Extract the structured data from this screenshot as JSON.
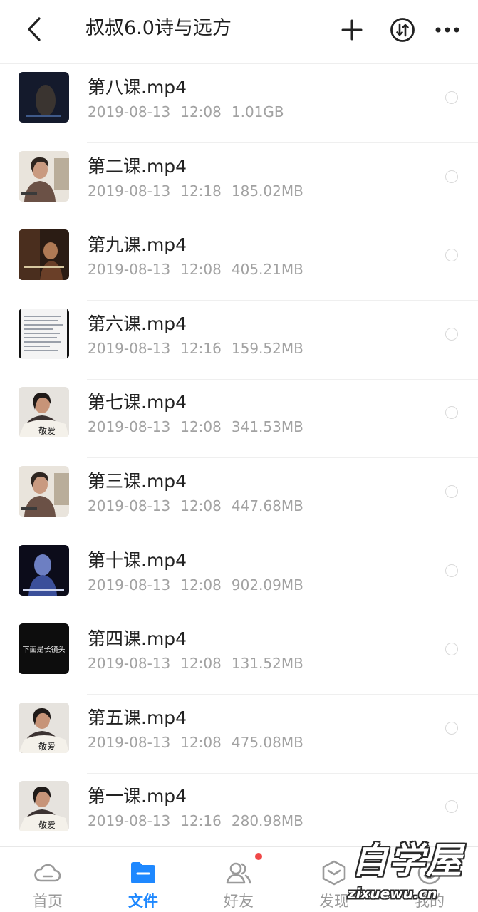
{
  "header": {
    "title": "叔叔6.0诗与远方",
    "back_icon": "chevron-left-icon",
    "actions": [
      "plus-icon",
      "sort-icon",
      "more-icon"
    ]
  },
  "files": [
    {
      "name": "第八课.mp4",
      "date": "2019-08-13",
      "time": "12:08",
      "size": "1.01GB",
      "thumb": "dark-scene"
    },
    {
      "name": "第二课.mp4",
      "date": "2019-08-13",
      "time": "12:18",
      "size": "185.02MB",
      "thumb": "person-light"
    },
    {
      "name": "第九课.mp4",
      "date": "2019-08-13",
      "time": "12:08",
      "size": "405.21MB",
      "thumb": "warm-scene"
    },
    {
      "name": "第六课.mp4",
      "date": "2019-08-13",
      "time": "12:16",
      "size": "159.52MB",
      "thumb": "document"
    },
    {
      "name": "第七课.mp4",
      "date": "2019-08-13",
      "time": "12:08",
      "size": "341.53MB",
      "thumb": "person-fan"
    },
    {
      "name": "第三课.mp4",
      "date": "2019-08-13",
      "time": "12:08",
      "size": "447.68MB",
      "thumb": "person-light"
    },
    {
      "name": "第十课.mp4",
      "date": "2019-08-13",
      "time": "12:08",
      "size": "902.09MB",
      "thumb": "blue-scene"
    },
    {
      "name": "第四课.mp4",
      "date": "2019-08-13",
      "time": "12:08",
      "size": "131.52MB",
      "thumb": "black-title",
      "thumb_text": "下面是长镜头"
    },
    {
      "name": "第五课.mp4",
      "date": "2019-08-13",
      "time": "12:08",
      "size": "475.08MB",
      "thumb": "person-fan"
    },
    {
      "name": "第一课.mp4",
      "date": "2019-08-13",
      "time": "12:16",
      "size": "280.98MB",
      "thumb": "person-fan"
    }
  ],
  "tabs": [
    {
      "label": "首页",
      "icon": "cloud-icon",
      "active": false
    },
    {
      "label": "文件",
      "icon": "folder-icon",
      "active": true
    },
    {
      "label": "好友",
      "icon": "friends-icon",
      "active": false,
      "badge": true
    },
    {
      "label": "发现",
      "icon": "discover-icon",
      "active": false
    },
    {
      "label": "我的",
      "icon": "profile-icon",
      "active": false
    }
  ],
  "watermark": {
    "big": "自学屋",
    "small": "zixuewu.cn"
  },
  "colors": {
    "accent": "#1e88ff",
    "badge": "#f04848",
    "meta": "#a2a2a2"
  }
}
